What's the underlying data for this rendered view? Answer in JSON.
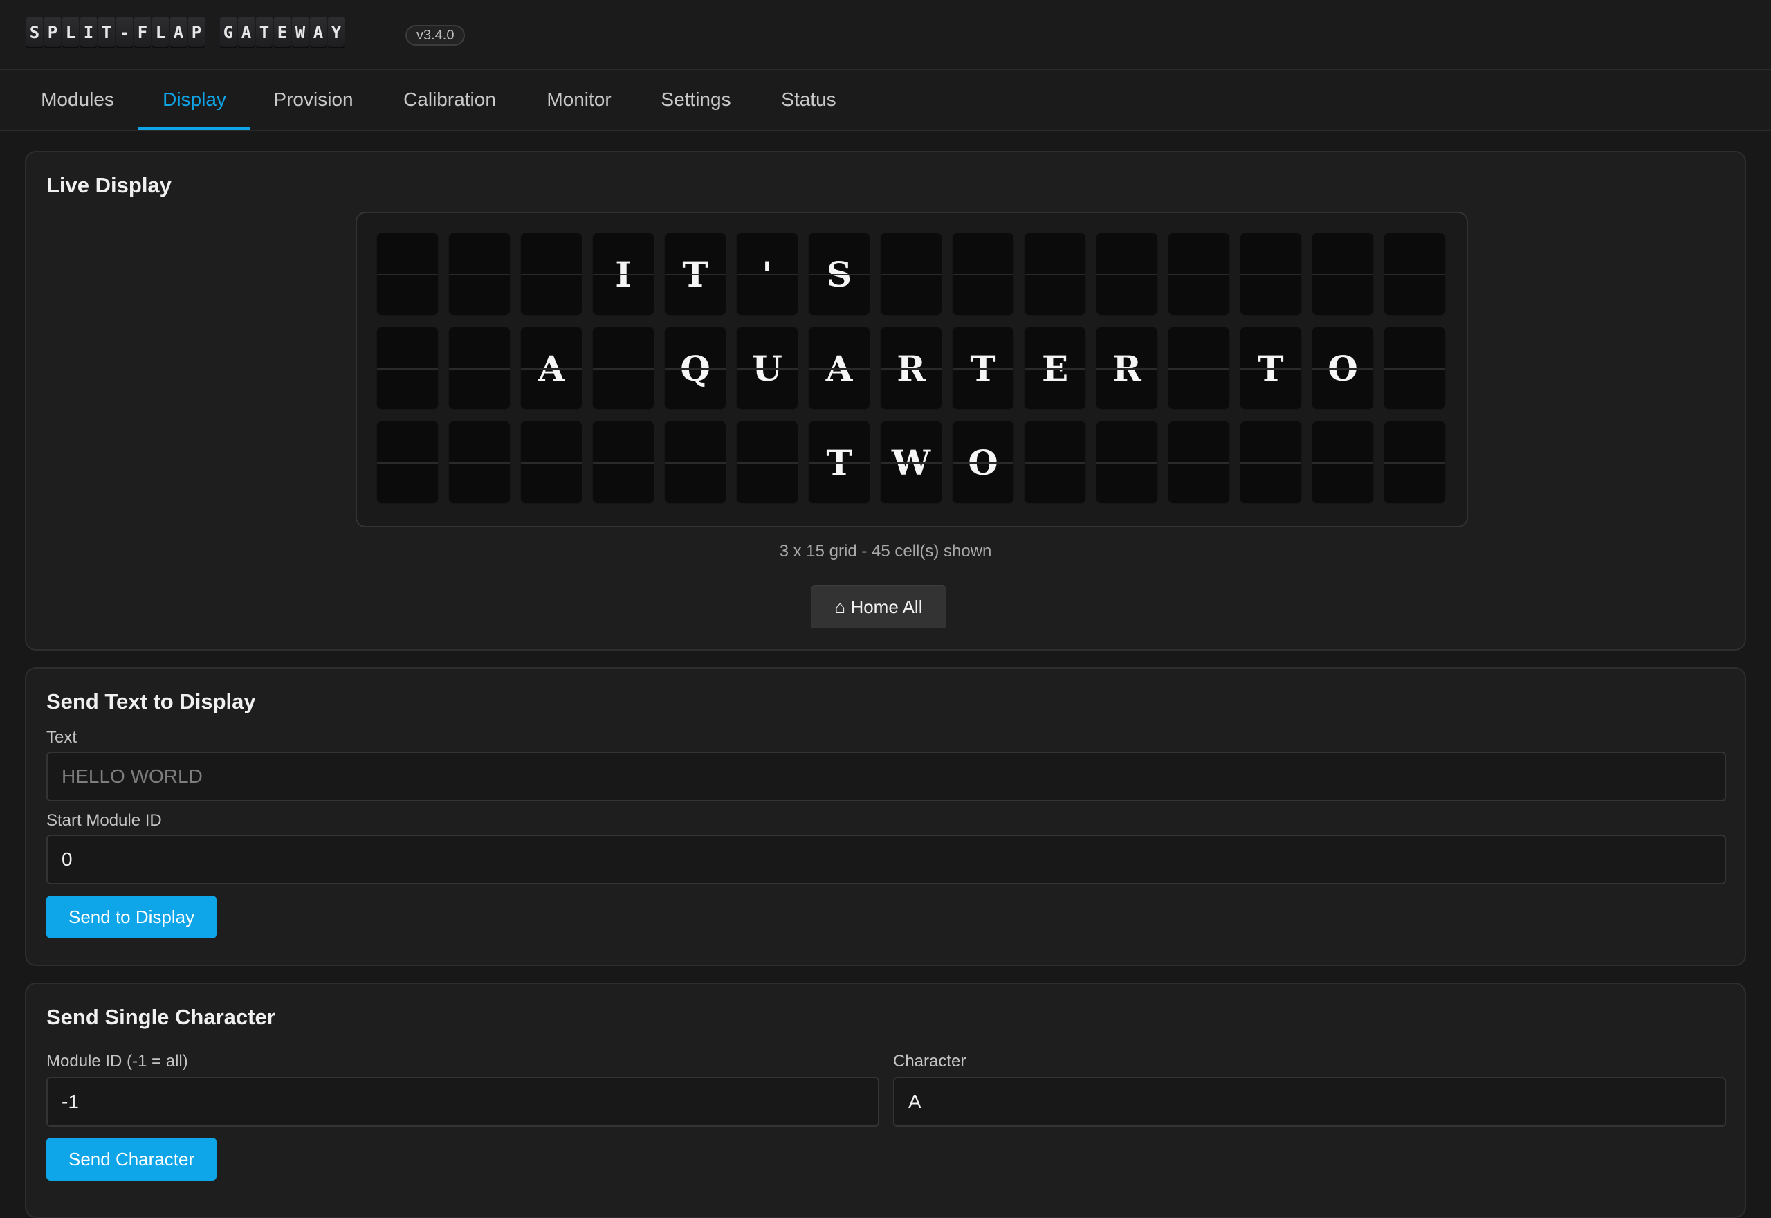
{
  "header": {
    "brand_words": [
      "SPLIT-FLAP",
      "GATEWAY"
    ],
    "version": "v3.4.0"
  },
  "tabs": [
    {
      "label": "Modules"
    },
    {
      "label": "Display",
      "active": true
    },
    {
      "label": "Provision"
    },
    {
      "label": "Calibration"
    },
    {
      "label": "Monitor"
    },
    {
      "label": "Settings"
    },
    {
      "label": "Status"
    }
  ],
  "live_display": {
    "title": "Live Display",
    "rows": [
      [
        "",
        "",
        "",
        "I",
        "T",
        "'",
        "S",
        "",
        "",
        "",
        "",
        "",
        "",
        "",
        ""
      ],
      [
        "",
        "",
        "A",
        "",
        "Q",
        "U",
        "A",
        "R",
        "T",
        "E",
        "R",
        "",
        "T",
        "O",
        ""
      ],
      [
        "",
        "",
        "",
        "",
        "",
        "",
        "T",
        "W",
        "O",
        "",
        "",
        "",
        "",
        "",
        ""
      ]
    ],
    "caption": "3 x 15 grid - 45 cell(s) shown",
    "home_button": "⌂ Home All"
  },
  "send_text": {
    "title": "Send Text to Display",
    "text_label": "Text",
    "text_placeholder": "HELLO WORLD",
    "start_label": "Start Module ID",
    "start_value": "0",
    "button": "Send to Display"
  },
  "send_char": {
    "title": "Send Single Character",
    "module_label": "Module ID (-1 = all)",
    "module_value": "-1",
    "char_label": "Character",
    "char_value": "A",
    "button": "Send Character"
  },
  "colors": {
    "accent": "#0ea5e9",
    "background": "#181818",
    "panel": "#1e1e1e"
  }
}
